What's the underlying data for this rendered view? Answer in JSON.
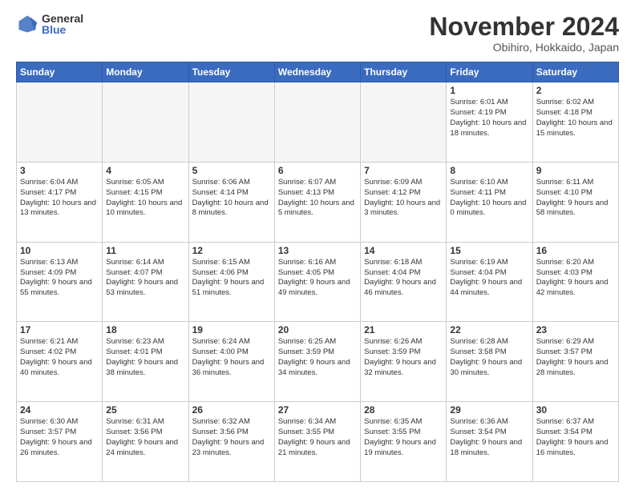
{
  "logo": {
    "general": "General",
    "blue": "Blue"
  },
  "title": "November 2024",
  "location": "Obihiro, Hokkaido, Japan",
  "headers": [
    "Sunday",
    "Monday",
    "Tuesday",
    "Wednesday",
    "Thursday",
    "Friday",
    "Saturday"
  ],
  "weeks": [
    [
      {
        "day": "",
        "info": "",
        "empty": true
      },
      {
        "day": "",
        "info": "",
        "empty": true
      },
      {
        "day": "",
        "info": "",
        "empty": true
      },
      {
        "day": "",
        "info": "",
        "empty": true
      },
      {
        "day": "",
        "info": "",
        "empty": true
      },
      {
        "day": "1",
        "info": "Sunrise: 6:01 AM\nSunset: 4:19 PM\nDaylight: 10 hours and 18 minutes."
      },
      {
        "day": "2",
        "info": "Sunrise: 6:02 AM\nSunset: 4:18 PM\nDaylight: 10 hours and 15 minutes."
      }
    ],
    [
      {
        "day": "3",
        "info": "Sunrise: 6:04 AM\nSunset: 4:17 PM\nDaylight: 10 hours and 13 minutes."
      },
      {
        "day": "4",
        "info": "Sunrise: 6:05 AM\nSunset: 4:15 PM\nDaylight: 10 hours and 10 minutes."
      },
      {
        "day": "5",
        "info": "Sunrise: 6:06 AM\nSunset: 4:14 PM\nDaylight: 10 hours and 8 minutes."
      },
      {
        "day": "6",
        "info": "Sunrise: 6:07 AM\nSunset: 4:13 PM\nDaylight: 10 hours and 5 minutes."
      },
      {
        "day": "7",
        "info": "Sunrise: 6:09 AM\nSunset: 4:12 PM\nDaylight: 10 hours and 3 minutes."
      },
      {
        "day": "8",
        "info": "Sunrise: 6:10 AM\nSunset: 4:11 PM\nDaylight: 10 hours and 0 minutes."
      },
      {
        "day": "9",
        "info": "Sunrise: 6:11 AM\nSunset: 4:10 PM\nDaylight: 9 hours and 58 minutes."
      }
    ],
    [
      {
        "day": "10",
        "info": "Sunrise: 6:13 AM\nSunset: 4:09 PM\nDaylight: 9 hours and 55 minutes."
      },
      {
        "day": "11",
        "info": "Sunrise: 6:14 AM\nSunset: 4:07 PM\nDaylight: 9 hours and 53 minutes."
      },
      {
        "day": "12",
        "info": "Sunrise: 6:15 AM\nSunset: 4:06 PM\nDaylight: 9 hours and 51 minutes."
      },
      {
        "day": "13",
        "info": "Sunrise: 6:16 AM\nSunset: 4:05 PM\nDaylight: 9 hours and 49 minutes."
      },
      {
        "day": "14",
        "info": "Sunrise: 6:18 AM\nSunset: 4:04 PM\nDaylight: 9 hours and 46 minutes."
      },
      {
        "day": "15",
        "info": "Sunrise: 6:19 AM\nSunset: 4:04 PM\nDaylight: 9 hours and 44 minutes."
      },
      {
        "day": "16",
        "info": "Sunrise: 6:20 AM\nSunset: 4:03 PM\nDaylight: 9 hours and 42 minutes."
      }
    ],
    [
      {
        "day": "17",
        "info": "Sunrise: 6:21 AM\nSunset: 4:02 PM\nDaylight: 9 hours and 40 minutes."
      },
      {
        "day": "18",
        "info": "Sunrise: 6:23 AM\nSunset: 4:01 PM\nDaylight: 9 hours and 38 minutes."
      },
      {
        "day": "19",
        "info": "Sunrise: 6:24 AM\nSunset: 4:00 PM\nDaylight: 9 hours and 36 minutes."
      },
      {
        "day": "20",
        "info": "Sunrise: 6:25 AM\nSunset: 3:59 PM\nDaylight: 9 hours and 34 minutes."
      },
      {
        "day": "21",
        "info": "Sunrise: 6:26 AM\nSunset: 3:59 PM\nDaylight: 9 hours and 32 minutes."
      },
      {
        "day": "22",
        "info": "Sunrise: 6:28 AM\nSunset: 3:58 PM\nDaylight: 9 hours and 30 minutes."
      },
      {
        "day": "23",
        "info": "Sunrise: 6:29 AM\nSunset: 3:57 PM\nDaylight: 9 hours and 28 minutes."
      }
    ],
    [
      {
        "day": "24",
        "info": "Sunrise: 6:30 AM\nSunset: 3:57 PM\nDaylight: 9 hours and 26 minutes."
      },
      {
        "day": "25",
        "info": "Sunrise: 6:31 AM\nSunset: 3:56 PM\nDaylight: 9 hours and 24 minutes."
      },
      {
        "day": "26",
        "info": "Sunrise: 6:32 AM\nSunset: 3:56 PM\nDaylight: 9 hours and 23 minutes."
      },
      {
        "day": "27",
        "info": "Sunrise: 6:34 AM\nSunset: 3:55 PM\nDaylight: 9 hours and 21 minutes."
      },
      {
        "day": "28",
        "info": "Sunrise: 6:35 AM\nSunset: 3:55 PM\nDaylight: 9 hours and 19 minutes."
      },
      {
        "day": "29",
        "info": "Sunrise: 6:36 AM\nSunset: 3:54 PM\nDaylight: 9 hours and 18 minutes."
      },
      {
        "day": "30",
        "info": "Sunrise: 6:37 AM\nSunset: 3:54 PM\nDaylight: 9 hours and 16 minutes."
      }
    ]
  ]
}
